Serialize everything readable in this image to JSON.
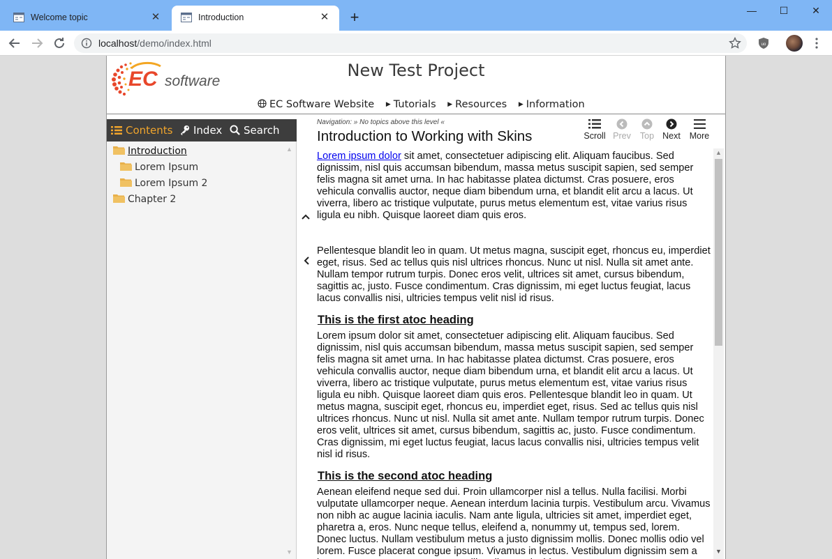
{
  "browser": {
    "tabs": [
      {
        "title": "Welcome topic",
        "active": false
      },
      {
        "title": "Introduction",
        "active": true
      }
    ],
    "new_tab": "+",
    "url_host": "localhost",
    "url_path": "/demo/index.html"
  },
  "header": {
    "logo_text": "ECsoftware",
    "project_title": "New Test Project",
    "links": [
      {
        "label": "EC Software Website",
        "icon": "globe-icon"
      },
      {
        "label": "Tutorials",
        "icon": "triangle-right-icon"
      },
      {
        "label": "Resources",
        "icon": "triangle-right-icon"
      },
      {
        "label": "Information",
        "icon": "triangle-right-icon"
      }
    ]
  },
  "sidebar": {
    "tabs": [
      {
        "label": "Contents",
        "icon": "list-icon",
        "active": true
      },
      {
        "label": "Index",
        "icon": "key-icon",
        "active": false
      },
      {
        "label": "Search",
        "icon": "search-icon",
        "active": false
      }
    ],
    "toc": [
      {
        "label": "Introduction",
        "level": 0,
        "selected": true
      },
      {
        "label": "Lorem Ipsum",
        "level": 1
      },
      {
        "label": "Lorem Ipsum 2",
        "level": 1
      },
      {
        "label": "Chapter 2",
        "level": 0
      }
    ]
  },
  "topic": {
    "nav_label": "Navigation:",
    "nav_text": " » No topics above this level «",
    "title": "Introduction to Working with Skins",
    "toolbar": {
      "scroll": "Scroll",
      "prev": "Prev",
      "top": "Top",
      "next": "Next",
      "more": "More"
    },
    "p1_link": "Lorem ipsum dolor",
    "p1_rest": " sit amet, consectetuer adipiscing elit. Aliquam faucibus. Sed dignissim, nisl quis accumsan bibendum, massa metus suscipit sapien, sed semper felis magna sit amet urna. In hac habitasse platea dictumst. Cras posuere, eros vehicula convallis auctor, neque diam bibendum urna, et blandit elit arcu a lacus. Ut viverra, libero ac tristique vulputate, purus metus elementum est, vitae varius risus ligula eu nibh. Quisque laoreet diam quis eros.",
    "p2": "Pellentesque blandit leo in quam. Ut metus magna, suscipit eget, rhoncus eu, imperdiet eget, risus. Sed ac tellus quis nisl ultrices rhoncus. Nunc ut nisl. Nulla sit amet ante. Nullam tempor rutrum turpis. Donec eros velit, ultrices sit amet, cursus bibendum, sagittis ac, justo. Fusce condimentum. Cras dignissim, mi eget luctus feugiat, lacus lacus convallis nisi, ultricies tempus velit nisl id risus.",
    "h1": "This is the first atoc heading",
    "p3": "Lorem ipsum dolor sit amet, consectetuer adipiscing elit. Aliquam faucibus. Sed dignissim, nisl quis accumsan bibendum, massa metus suscipit sapien, sed semper felis magna sit amet urna. In hac habitasse platea dictumst. Cras posuere, eros vehicula convallis auctor, neque diam bibendum urna, et blandit elit arcu a lacus. Ut viverra, libero ac tristique vulputate, purus metus elementum est, vitae varius risus ligula eu nibh. Quisque laoreet diam quis eros. Pellentesque blandit leo in quam. Ut metus magna, suscipit eget, rhoncus eu, imperdiet eget, risus. Sed ac tellus quis nisl ultrices rhoncus. Nunc ut nisl. Nulla sit amet ante. Nullam tempor rutrum turpis. Donec eros velit, ultrices sit amet, cursus bibendum, sagittis ac, justo. Fusce condimentum. Cras dignissim, mi eget luctus feugiat, lacus lacus convallis nisi, ultricies tempus velit nisl id risus.",
    "h2": "This is the second atoc heading",
    "p4": "Aenean eleifend neque sed dui. Proin ullamcorper nisl a tellus. Nulla facilisi. Morbi vulputate ullamcorper neque. Aenean interdum lacinia turpis. Vestibulum arcu. Vivamus non nibh ac augue lacinia iaculis. Nam ante ligula, ultricies sit amet, imperdiet eget, pharetra a, eros. Nunc neque tellus, eleifend a, nonummy ut, tempus sed, lorem. Donec luctus. Nullam vestibulum metus a justo dignissim mollis. Donec mollis odio vel lorem. Fusce placerat congue ipsum. Vivamus in lectus. Vestibulum dignissim sem a ipsum. Cras accumsan. Fusce mollis. Aliquam tincidunt."
  },
  "colors": {
    "tabstrip": "#7fb6f5",
    "accent_orange": "#f1a52c",
    "sidebar_tabs_bg": "#3d3d3d",
    "link": "#0000ee"
  }
}
